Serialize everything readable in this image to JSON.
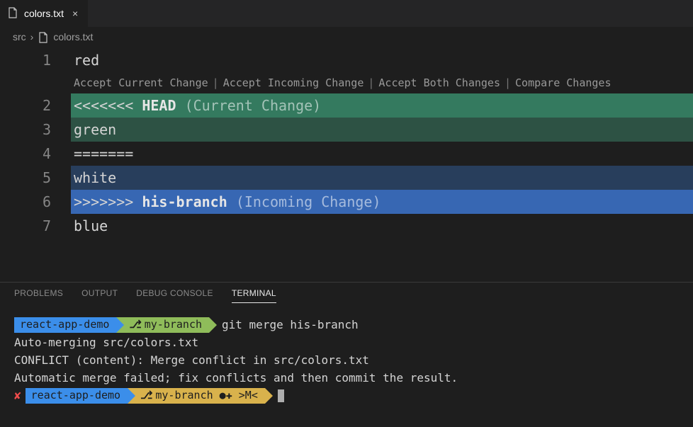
{
  "tab": {
    "filename": "colors.txt"
  },
  "breadcrumbs": {
    "folder": "src",
    "file": "colors.txt"
  },
  "codelens": {
    "accept_current": "Accept Current Change",
    "accept_incoming": "Accept Incoming Change",
    "accept_both": "Accept Both Changes",
    "compare": "Compare Changes"
  },
  "editor": {
    "lines": {
      "1": "red",
      "2_markers": "<<<<<<<",
      "2_ref": "HEAD",
      "2_label": "(Current Change)",
      "3": "green",
      "4": "=======",
      "5": "white",
      "6_markers": ">>>>>>>",
      "6_ref": "his-branch",
      "6_label": "(Incoming Change)",
      "7": "blue"
    }
  },
  "panel": {
    "tabs": {
      "problems": "PROBLEMS",
      "output": "OUTPUT",
      "debug": "DEBUG CONSOLE",
      "terminal": "TERMINAL"
    }
  },
  "terminal": {
    "prompt1": {
      "dir": "react-app-demo",
      "branch": "my-branch",
      "cmd": "git merge his-branch"
    },
    "out1": "Auto-merging src/colors.txt",
    "out2": "CONFLICT (content): Merge conflict in src/colors.txt",
    "out3": "Automatic merge failed; fix conflicts and then commit the result.",
    "prompt2": {
      "dir": "react-app-demo",
      "branch_status": "my-branch ●✚ >M<"
    }
  }
}
